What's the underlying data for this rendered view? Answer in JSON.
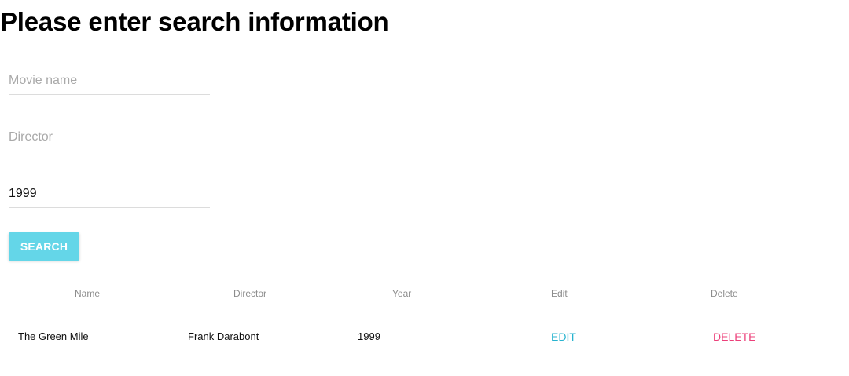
{
  "page": {
    "title": "Please enter search information"
  },
  "form": {
    "movie_name": {
      "placeholder": "Movie name",
      "value": ""
    },
    "director": {
      "placeholder": "Director",
      "value": ""
    },
    "year": {
      "placeholder": "",
      "value": "1999"
    },
    "search_label": "SEARCH"
  },
  "table": {
    "headers": [
      "Name",
      "Director",
      "Year",
      "Edit",
      "Delete"
    ],
    "rows": [
      {
        "name": "The Green Mile",
        "director": "Frank Darabont",
        "year": "1999",
        "edit_label": "EDIT",
        "delete_label": "DELETE"
      }
    ]
  },
  "colors": {
    "search_button": "#64d6e8",
    "edit_link": "#27b3cf",
    "delete_link": "#ec407a"
  }
}
